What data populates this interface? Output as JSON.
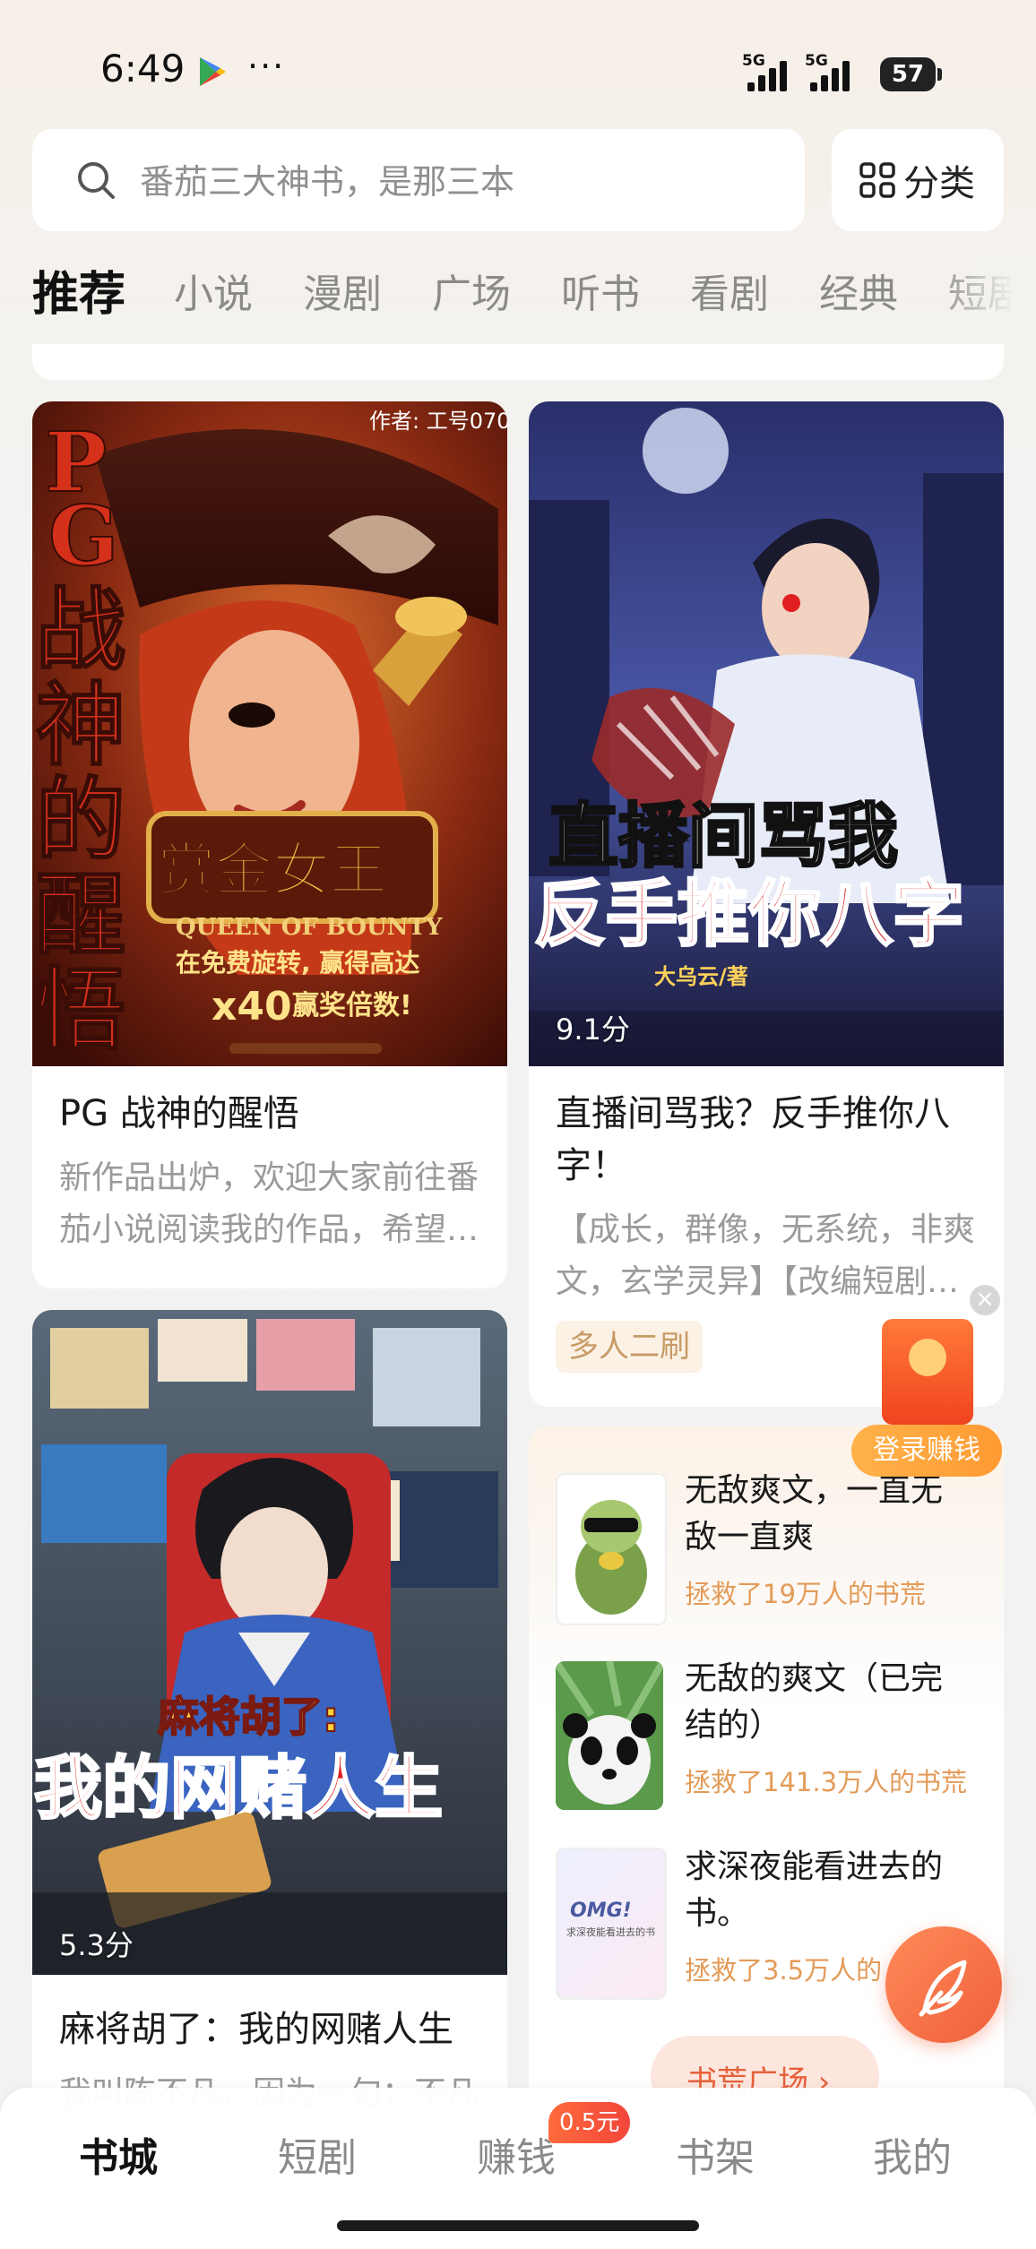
{
  "status_bar": {
    "time": "6:49",
    "more": "···",
    "net1": "5G",
    "net2": "5G",
    "battery": "57"
  },
  "search": {
    "placeholder": "番茄三大神书，是那三本",
    "icon": "search-icon"
  },
  "category_button": {
    "label": "分类",
    "icon": "grid-icon"
  },
  "tabs": [
    {
      "label": "推荐",
      "active": true
    },
    {
      "label": "小说"
    },
    {
      "label": "漫剧"
    },
    {
      "label": "广场"
    },
    {
      "label": "听书"
    },
    {
      "label": "看剧"
    },
    {
      "label": "经典"
    },
    {
      "label": "短剧"
    }
  ],
  "cards": {
    "pg": {
      "title": "PG 战神的醒悟",
      "desc": [
        "新作品出炉，欢迎大家前往番",
        "茄小说阅读我的作品，希望…"
      ],
      "cover": {
        "side_text": [
          "P",
          "G",
          "战",
          "神",
          "的",
          "醒",
          "悟"
        ],
        "author": "作者: 工号070",
        "banner": "赏金女王",
        "banner_en": "QUEEN OF BOUNTY",
        "promo": "在免费旋转, 赢得高达",
        "multiplier": "x40",
        "multiplier_text": "赢奖倍数!"
      }
    },
    "live": {
      "title": [
        "直播间骂我？反手推你八",
        "字！"
      ],
      "desc": [
        "【成长，群像，无系统，非爽",
        "文，玄学灵异】【改编短剧…"
      ],
      "tag": "多人二刷",
      "score": "9.1分",
      "cover": {
        "line1": "直播间骂我",
        "line2": "反手推你八字",
        "author": "大乌云/著"
      }
    },
    "mahjong": {
      "title": "麻将胡了：我的网赌人生",
      "desc": "我叫陈不凡，因为一句：不凡",
      "score": "5.3分",
      "cover": {
        "line1": "麻将胡了:",
        "line2": "我的网赌人生"
      }
    }
  },
  "ranking": {
    "items": [
      {
        "title": [
          "无敌爽文，一直无",
          "敌一直爽"
        ],
        "sub": "拯救了19万人的书荒",
        "thumb": "turtle"
      },
      {
        "title": [
          "无敌的爽文（已完",
          "结的）"
        ],
        "sub": "拯救了141.3万人的书荒",
        "thumb": "panda"
      },
      {
        "title": [
          "求深夜能看进去的",
          "书。"
        ],
        "sub": "拯救了3.5万人的",
        "thumb": "omg",
        "thumb_text": "OMG!",
        "thumb_small": "求深夜能看进去的书"
      }
    ],
    "plaza_button": "书荒广场 ›"
  },
  "floating": {
    "earn_label": "登录赚钱",
    "close": "×"
  },
  "bottom_nav": {
    "items": [
      {
        "label": "书城",
        "active": true
      },
      {
        "label": "短剧"
      },
      {
        "label": "赚钱",
        "badge": "0.5元"
      },
      {
        "label": "书架"
      },
      {
        "label": "我的"
      }
    ]
  }
}
